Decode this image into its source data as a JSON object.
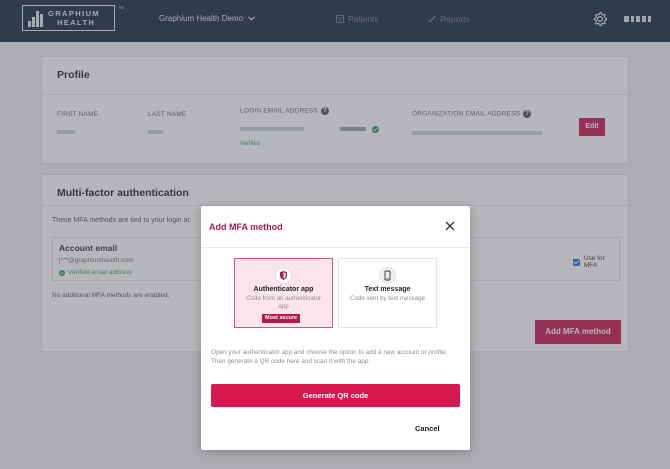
{
  "nav": {
    "logo_line1": "GRAPHIUM",
    "logo_line2": "HEALTH",
    "logo_tm": "TM",
    "org_name": "Graphium Health Demo",
    "patients_label": "Patients",
    "reports_label": "Reports",
    "icons": [
      "chevron-down-icon",
      "patients-icon",
      "reports-icon",
      "gear-icon"
    ],
    "background_color": "#1b2a44"
  },
  "profile": {
    "title": "Profile",
    "first_name_label": "FIRST NAME",
    "last_name_label": "LAST NAME",
    "login_email_label": "LOGIN EMAIL ADDRESS",
    "org_email_label": "ORGANIZATION EMAIL ADDRESS",
    "login_verified": "Verified",
    "edit_label": "Edit"
  },
  "mfa": {
    "title": "Multi-factor authentication",
    "description": "These MFA methods are tied to your login ac",
    "account_title": "Account email",
    "account_email": "j***@graphiumhealth.com",
    "account_verified": "Verified email address",
    "use_for_mfa": "Use for MFA",
    "use_for_mfa_checked": true,
    "no_additional": "No additional MFA methods are enabled.",
    "add_button": "Add MFA method"
  },
  "modal": {
    "title": "Add MFA method",
    "options": [
      {
        "title": "Authenticator app",
        "subtitle": "Code from an authenticator app",
        "badge": "Most secure",
        "icon": "shield-icon",
        "selected": true
      },
      {
        "title": "Text message",
        "subtitle": "Code sent by text message",
        "icon": "phone-icon",
        "selected": false
      }
    ],
    "instructions": "Open your authenticator app and choose the option to add a new account or profile. Then generate a QR code here and scan it with the app.",
    "generate_label": "Generate QR code",
    "cancel_label": "Cancel"
  },
  "colors": {
    "accent": "#c8174f",
    "modal_title": "#b11a4a",
    "verified_green": "#3c9a5a"
  }
}
